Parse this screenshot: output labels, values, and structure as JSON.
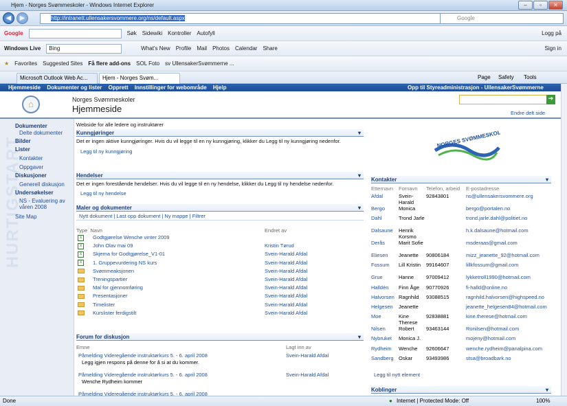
{
  "window": {
    "title": "Hjem - Norges Svømmeskoler - Windows Internet Explorer"
  },
  "address": {
    "url": "http://intranett.ullensakersvommere.org/ns/default.aspx",
    "search_placeholder": "Google"
  },
  "google_bar": {
    "brand": "Google",
    "items": [
      "Søk",
      "Sidewiki",
      "Kontroller",
      "Autofyll"
    ],
    "login": "Logg på"
  },
  "live_bar": {
    "brand": "Windows Live",
    "search_value": "Bing",
    "items": [
      "What's New",
      "Profile",
      "Mail",
      "Photos",
      "Calendar",
      "Share"
    ],
    "signin": "Sign in"
  },
  "fav_bar": {
    "items": [
      "Favorites",
      "Suggested Sites",
      "Få flere add-ons",
      "SOL Foto",
      "sv UllensakerSvømmerne ..."
    ]
  },
  "tabs": {
    "items": [
      "Microsoft Outlook Web Ac...",
      "Hjem - Norges Svøm..."
    ],
    "cmd": [
      "Page",
      "Safety",
      "Tools"
    ]
  },
  "sp": {
    "top": [
      "Hjemmeside",
      "Dokumenter og lister",
      "Opprett",
      "Innstillinger for webområde",
      "Hjelp"
    ],
    "top_right": "Opp til Styreadministrasjon - UllensakerSvømmerne",
    "site": "Norges Svømmeskoler",
    "page": "Hjemmeside",
    "edit": "Endre delt side"
  },
  "nav": [
    {
      "label": "Dokumenter",
      "head": true
    },
    {
      "label": "Delte dokumenter"
    },
    {
      "label": "Bilder",
      "head": true
    },
    {
      "label": "Lister",
      "head": true
    },
    {
      "label": "Kontakter"
    },
    {
      "label": "Oppgaver"
    },
    {
      "label": "Diskusjoner",
      "head": true
    },
    {
      "label": "Generell diskusjon"
    },
    {
      "label": "Undersøkelser",
      "head": true
    },
    {
      "label": "NS - Evaluering av"
    },
    {
      "label": "våren 2008"
    },
    {
      "label": "Site Map"
    }
  ],
  "intro": "Webside for alle ledere og instruktører",
  "announcements": {
    "title": "Kunngjøringer",
    "text": "Det er ingen aktive kunngjøringer. Hvis du vil legge til en ny kunngjøring, klikker du Legg til ny kunngjøring nedenfor.",
    "add": "Legg til ny kunngjøring"
  },
  "events": {
    "title": "Hendelser",
    "text": "Det er ingen forestående hendelser. Hvis du vil legge til en ny hendelse, klikker du Legg til ny hendelse nedenfor.",
    "add": "Legg til ny hendelse"
  },
  "docs": {
    "title": "Maler og dokumenter",
    "toolbar": [
      "Nytt dokument",
      "Last opp dokument",
      "Ny mappe",
      "Filtrer"
    ],
    "col_type": "Type",
    "col_name": "Navn",
    "col_by": "Endret av",
    "rows": [
      {
        "name": "Godtgjørelse Wenche vinter 2009",
        "by": "",
        "kind": "doc"
      },
      {
        "name": "John Olav mai 09",
        "by": "Kristin Tørud",
        "kind": "doc"
      },
      {
        "name": "Skjema for Godtgjørelse_V1-01",
        "by": "Svein-Harald Afdal",
        "kind": "doc"
      },
      {
        "name": "1. Gruppevurdering NS kurs",
        "by": "Svein-Harald Afdal",
        "kind": "doc"
      },
      {
        "name": "Svømmeaksjonen",
        "by": "Svein-Harald Afdal",
        "kind": "folder"
      },
      {
        "name": "Treningspartier",
        "by": "Svein-Harald Afdal",
        "kind": "folder"
      },
      {
        "name": "Mal for gjennomføring",
        "by": "Svein-Harald Afdal",
        "kind": "folder"
      },
      {
        "name": "Presentasjoner",
        "by": "Svein-Harald Afdal",
        "kind": "folder"
      },
      {
        "name": "Timelister",
        "by": "Svein-Harald Afdal",
        "kind": "folder"
      },
      {
        "name": "Kurslister ferdigstilt",
        "by": "Svein-Harald Afdal",
        "kind": "folder"
      }
    ]
  },
  "forum": {
    "title": "Forum for diskusjon",
    "col_topic": "Emne",
    "col_by": "Lagt inn av",
    "rows": [
      {
        "title": "Påmelding Videregående instruktørkurs 5. - 6. april 2008",
        "by": "Svein-Harald Afdal",
        "body": "Legg igjen respons på denne for å si at du kommer."
      },
      {
        "title": "Påmelding Videregående instruktørkurs 5. - 6. april 2008",
        "by": "Svein-Harald Afdal",
        "body": "Wenche Rydheim kommer"
      },
      {
        "title": "Påmelding Videregående instruktørkurs 5. - 6. april 2008",
        "by": "",
        "body": ""
      }
    ]
  },
  "logo": {
    "text": "NORGES SVØMMESKOLE"
  },
  "contacts": {
    "title": "Kontakter",
    "cols": [
      "Etternavn",
      "Fornavn",
      "Telefon, arbeid",
      "E-postadresse"
    ],
    "rows": [
      {
        "last": "Afdal",
        "first": "Svein-Harald",
        "phone": "92843801",
        "email": "ns@ullensakersvommere.org"
      },
      {
        "last": "Bergo",
        "first": "Monica",
        "phone": "",
        "email": "bergo@portalen.no"
      },
      {
        "last": "Dahl",
        "first": "Trond Jarle",
        "phone": "",
        "email": "trond.jarle.dahl@politiet.no"
      },
      {
        "last": "Dalsaune",
        "first": "Henrik Korsmo",
        "phone": "",
        "email": "h.k.dalsaune@hotmail.com"
      },
      {
        "last": "Derås",
        "first": "Marit Sofie",
        "phone": "",
        "email": "msderaas@gmail.com"
      },
      {
        "last": "Eliesen",
        "first": "Jeanette",
        "phone": "90806184",
        "email": "mizz_jeanette_92@hotmail.com"
      },
      {
        "last": "Fossum",
        "first": "Lill Kristin",
        "phone": "99164607",
        "email": "lillkfossum@gmail.com"
      },
      {
        "last": "Grue",
        "first": "Hanne",
        "phone": "97009412",
        "email": "lykketroll1990@hotmail.com"
      },
      {
        "last": "Halldén",
        "first": "Finn Åge",
        "phone": "90770926",
        "email": "fi-halld@online.no"
      },
      {
        "last": "Halvorsen",
        "first": "Ragnhild",
        "phone": "93088515",
        "email": "ragnhild.halvorsen@highspeed.no"
      },
      {
        "last": "Helgesen",
        "first": "Jeanette",
        "phone": "",
        "email": "jeanette_helgesen84@hotmail.com"
      },
      {
        "last": "Moe",
        "first": "Kine Therese",
        "phone": "92838881",
        "email": "kine.therese@hotmail.com"
      },
      {
        "last": "Nilsen",
        "first": "Robert",
        "phone": "93463144",
        "email": "Ronilsen@hotmail.com"
      },
      {
        "last": "Nybruket",
        "first": "Monica J.",
        "phone": "",
        "email": "mojeny@hotmail.com"
      },
      {
        "last": "Rydheim",
        "first": "Wenche",
        "phone": "92606647",
        "email": "wenche.rydheim@panalpina.com"
      },
      {
        "last": "Sandberg",
        "first": "Oskar",
        "phone": "93493986",
        "email": "stsa@broadbark.no"
      }
    ],
    "add": "Legg til nytt element"
  },
  "links": {
    "title": "Koblinger"
  },
  "status": {
    "left": "Done",
    "zone": "Internet | Protected Mode: Off",
    "zoom": "100%"
  }
}
